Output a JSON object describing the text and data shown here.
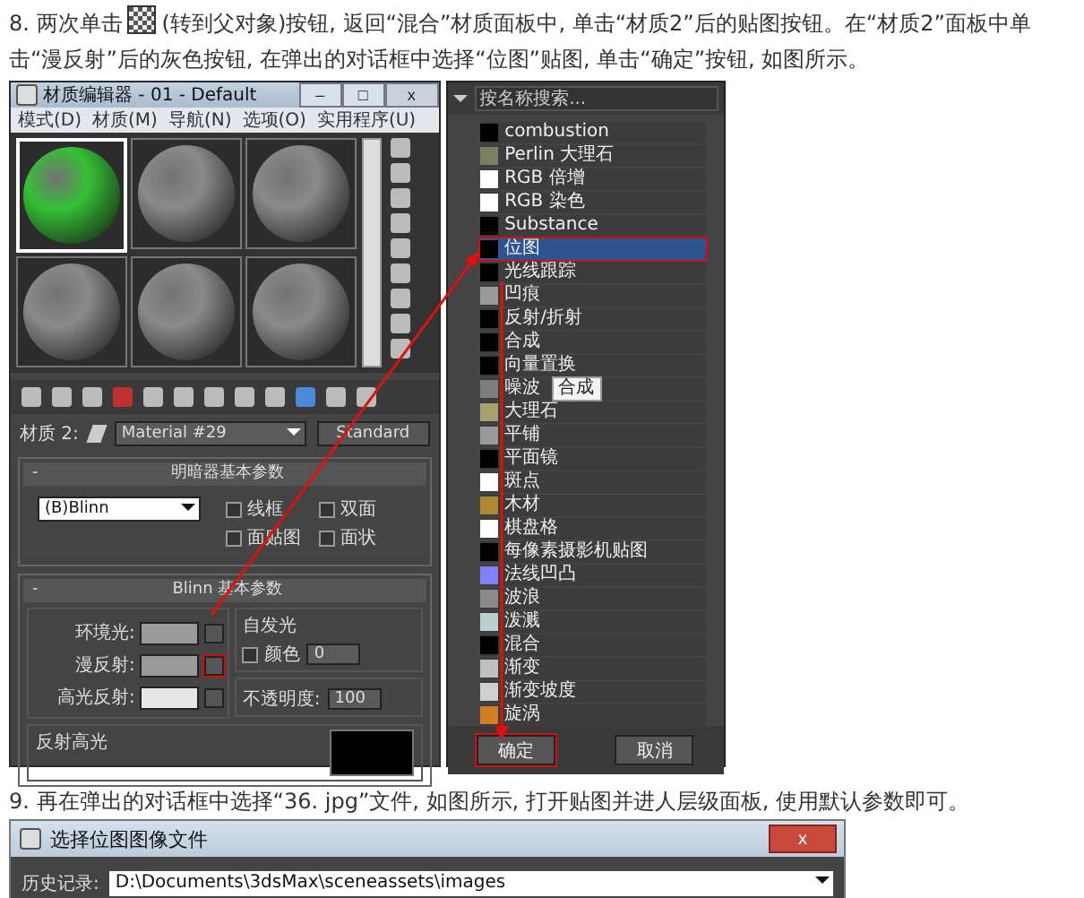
{
  "step8": {
    "before": "8. 两次单击",
    "after": "(转到父对象)按钮, 返回“混合”材质面板中, 单击“材质2”后的贴图按钮。在“材质2”面板中单击“漫反射”后的灰色按钮, 在弹出的对话框中选择“位图”贴图, 单击“确定”按钮, 如图所示。"
  },
  "material_editor": {
    "title": "材质编辑器 - 01 - Default",
    "window_buttons": [
      "–",
      "□",
      "x"
    ],
    "menu": [
      "模式(D)",
      "材质(M)",
      "导航(N)",
      "选项(O)",
      "实用程序(U)"
    ],
    "spheres": [
      {
        "color": "#35c035",
        "selected": true
      },
      {
        "color": "#8a8a8a",
        "selected": false
      },
      {
        "color": "#8a8a8a",
        "selected": false
      },
      {
        "color": "#8a8a8a",
        "selected": false
      },
      {
        "color": "#8a8a8a",
        "selected": false
      },
      {
        "color": "#8a8a8a",
        "selected": false
      }
    ],
    "collapse_sign": "-",
    "material_label": "材质 2:",
    "material_name": "Material #29",
    "material_type": "Standard",
    "shader_panel": {
      "title": "明暗器基本参数",
      "shader": "(B)Blinn",
      "options": [
        {
          "label": "线框",
          "checked": false
        },
        {
          "label": "双面",
          "checked": false
        },
        {
          "label": "面贴图",
          "checked": false
        },
        {
          "label": "面状",
          "checked": false
        }
      ]
    },
    "blinn_panel": {
      "title": "Blinn 基本参数",
      "colors": [
        {
          "label": "环境光:",
          "color": "#9a9a9a"
        },
        {
          "label": "漫反射:",
          "color": "#9a9a9a"
        },
        {
          "label": "高光反射:",
          "color": "#e6e6e6"
        }
      ],
      "self_illum": {
        "title": "自发光",
        "checkbox": {
          "label": "颜色",
          "checked": false
        },
        "value": "0"
      },
      "opacity": {
        "label": "不透明度:",
        "value": "100"
      },
      "specular_title": "反射高光"
    }
  },
  "map_browser": {
    "search": {
      "placeholder": "按名称搜索..."
    },
    "items": [
      {
        "name": "combustion",
        "color": "#000000",
        "selected": false
      },
      {
        "name": "Perlin 大理石",
        "color": "#7a8060",
        "selected": false
      },
      {
        "name": "RGB 倍增",
        "color": "#ffffff",
        "selected": false
      },
      {
        "name": "RGB 染色",
        "color": "#ffffff",
        "selected": false
      },
      {
        "name": "Substance",
        "color": "#000000",
        "selected": false
      },
      {
        "name": "位图",
        "color": "#000000",
        "selected": true
      },
      {
        "name": "光线跟踪",
        "color": "#000000",
        "selected": false
      },
      {
        "name": "凹痕",
        "color": "#9a9a9a",
        "selected": false
      },
      {
        "name": "反射/折射",
        "color": "#000000",
        "selected": false
      },
      {
        "name": "合成",
        "color": "#000000",
        "selected": false
      },
      {
        "name": "向量置换",
        "color": "#000000",
        "selected": false
      },
      {
        "name": "噪波",
        "color": "#7d7d7d",
        "selected": false,
        "tooltip": "合成"
      },
      {
        "name": "大理石",
        "color": "#a8a070",
        "selected": false
      },
      {
        "name": "平铺",
        "color": "#9a9a9a",
        "selected": false
      },
      {
        "name": "平面镜",
        "color": "#000000",
        "selected": false
      },
      {
        "name": "斑点",
        "color": "#ffffff",
        "selected": false
      },
      {
        "name": "木材",
        "color": "#b08830",
        "selected": false
      },
      {
        "name": "棋盘格",
        "color": "#ffffff",
        "selected": false
      },
      {
        "name": "每像素摄影机贴图",
        "color": "#000000",
        "selected": false
      },
      {
        "name": "法线凹凸",
        "color": "#8080ff",
        "selected": false
      },
      {
        "name": "波浪",
        "color": "#8a8a8a",
        "selected": false
      },
      {
        "name": "泼溅",
        "color": "#b8d0d0",
        "selected": false
      },
      {
        "name": "混合",
        "color": "#000000",
        "selected": false
      },
      {
        "name": "渐变",
        "color": "#c0c0c0",
        "selected": false
      },
      {
        "name": "渐变坡度",
        "color": "#d0d0d0",
        "selected": false
      },
      {
        "name": "旋涡",
        "color": "#d08020",
        "selected": false
      }
    ],
    "buttons": [
      "确定",
      "取消"
    ]
  },
  "step9": "9. 再在弹出的对话框中选择“36. jpg”文件, 如图所示, 打开贴图并进人层级面板, 使用默认参数即可。",
  "file_dialog": {
    "title": "选择位图图像文件",
    "close": "x",
    "history_label": "历史记录:",
    "history_value": "D:\\Documents\\3dsMax\\sceneassets\\images"
  }
}
